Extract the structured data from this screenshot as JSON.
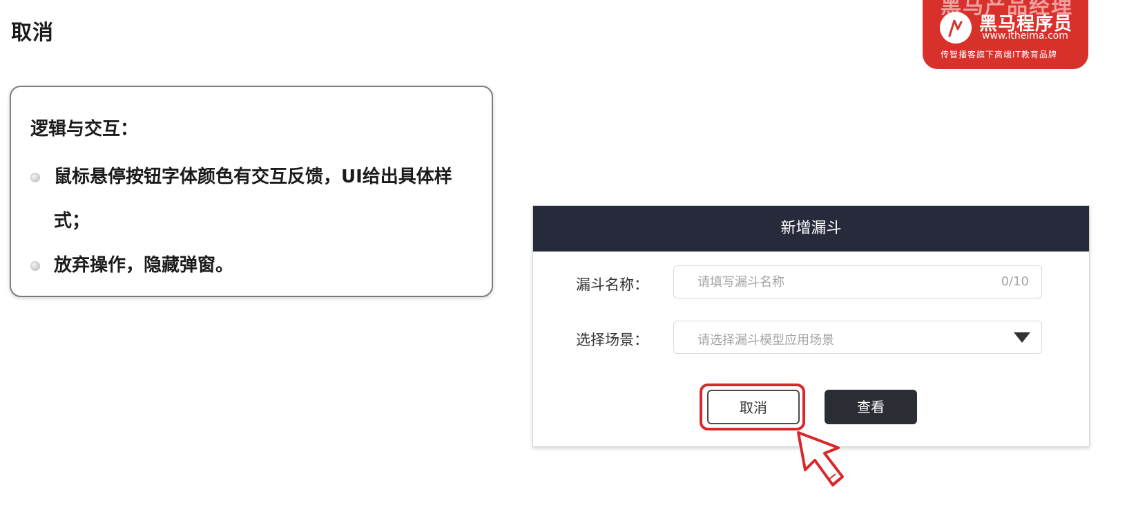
{
  "page": {
    "title": "取消"
  },
  "brand": {
    "top_text": "黑马产品经理",
    "name": "黑马程序员",
    "url": "www.itheima.com",
    "slogan": "传智播客旗下高端IT教育品牌",
    "color": "#d8302b"
  },
  "note": {
    "heading": "逻辑与交互：",
    "items": [
      "鼠标悬停按钮字体颜色有交互反馈，UI给出具体样式；",
      "放弃操作，隐藏弹窗。"
    ]
  },
  "dialog": {
    "title": "新增漏斗",
    "header_color": "#262a3b",
    "name_field": {
      "label": "漏斗名称：",
      "placeholder": "请填写漏斗名称",
      "counter": "0/10"
    },
    "scene_field": {
      "label": "选择场景：",
      "placeholder": "请选择漏斗模型应用场景"
    },
    "buttons": {
      "cancel": "取消",
      "view": "查看"
    },
    "highlight_color": "#d8282b",
    "pointer_icon": "hand-drawn-cursor-arrow-icon"
  }
}
